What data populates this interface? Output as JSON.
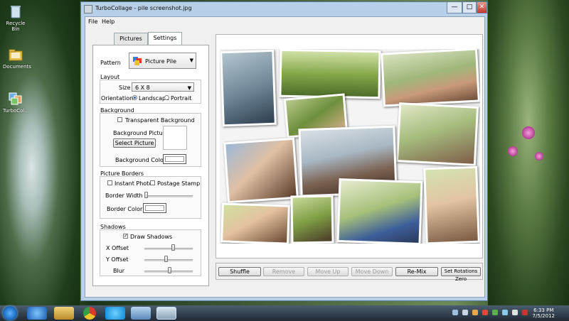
{
  "desktop": {
    "icons": [
      {
        "label": "Recycle Bin",
        "icon": "recycle-bin-icon"
      },
      {
        "label": "Documents",
        "icon": "folder-icon"
      },
      {
        "label": "TurboCol...",
        "icon": "turbocollage-shortcut-icon"
      }
    ]
  },
  "window": {
    "title": "TurboCollage - pile screenshot.jpg",
    "controls": {
      "minimize": "—",
      "maximize": "□",
      "close": "✕"
    }
  },
  "menu": {
    "file": "File",
    "help": "Help"
  },
  "tabs": [
    {
      "label": "Pictures"
    },
    {
      "label": "Settings"
    }
  ],
  "settings": {
    "pattern_label": "Pattern",
    "pattern_value": "Picture Pile",
    "layout": {
      "title": "Layout",
      "size_label": "Size",
      "size_value": "6 X 8",
      "orientation_label": "Orientation",
      "landscape": "Landscape",
      "portrait": "Portrait",
      "orientation_selected": "Landscape"
    },
    "background": {
      "title": "Background",
      "transparent_label": "Transparent Background",
      "transparent_checked": false,
      "picture_label": "Background Picture",
      "select_button": "Select Picture",
      "color_label": "Background Color",
      "color_value": "#ffffff"
    },
    "borders": {
      "title": "Picture Borders",
      "instant_label": "Instant Photo",
      "instant_checked": false,
      "stamp_label": "Postage Stamp",
      "stamp_checked": false,
      "width_label": "Border Width",
      "width_level": 0.0,
      "color_label": "Border Color",
      "color_value": "#ffffff"
    },
    "shadows": {
      "title": "Shadows",
      "draw_label": "Draw Shadows",
      "draw_checked": true,
      "x_label": "X Offset",
      "x_level": 0.6,
      "y_label": "Y Offset",
      "y_level": 0.45,
      "blur_label": "Blur",
      "blur_level": 0.52
    }
  },
  "actions": {
    "shuffle": "Shuffle",
    "remove": "Remove",
    "move_up": "Move Up",
    "move_down": "Move Down",
    "remix": "Re-Mix",
    "zero": "Set Rotations Zero"
  },
  "taskbar": {
    "time": "6:33 PM",
    "date": "7/5/2012",
    "apps": [
      "internet-explorer-icon",
      "file-explorer-icon",
      "chrome-icon",
      "skype-icon",
      "remote-desktop-icon",
      "turbocollage-taskbar-icon"
    ]
  },
  "colors": {
    "accent": "#2a5db0",
    "window_frame": "#b8cfe8"
  }
}
